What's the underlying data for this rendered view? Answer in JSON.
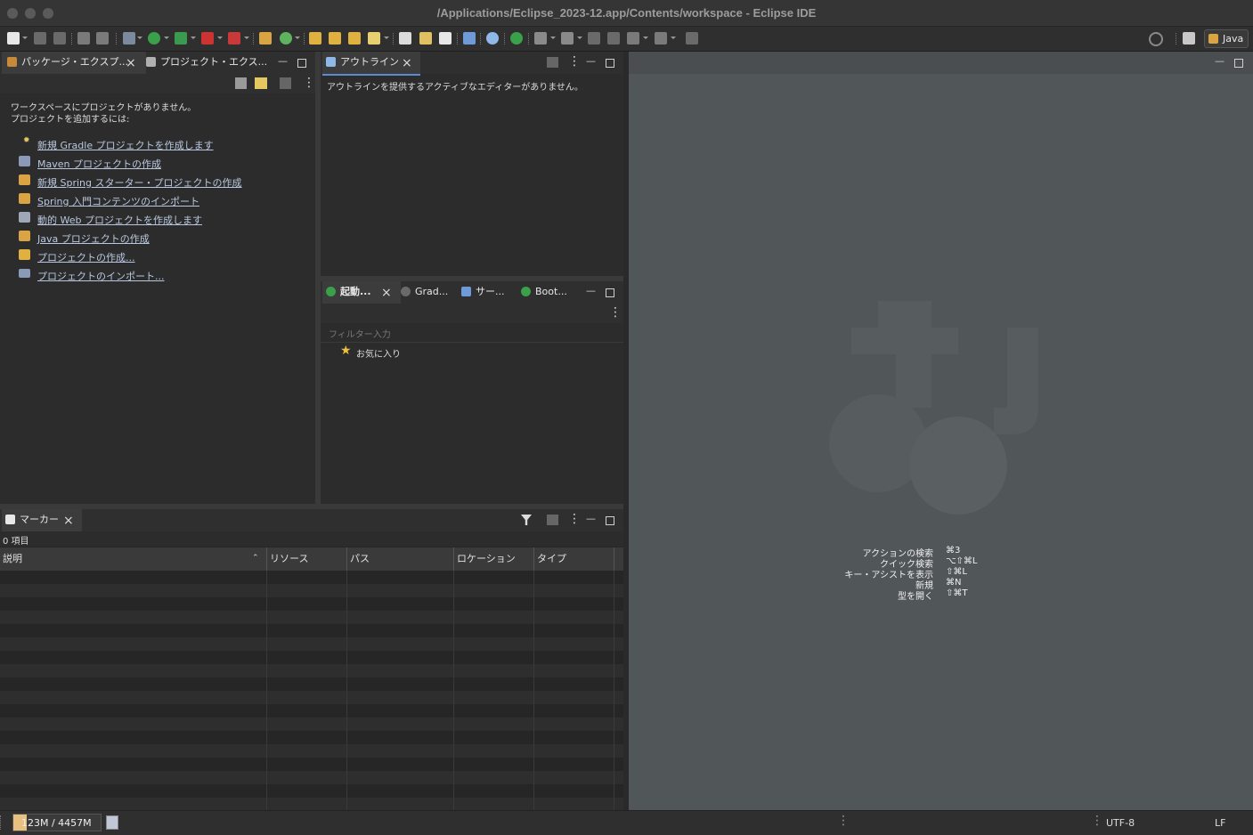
{
  "window": {
    "title": "/Applications/Eclipse_2023-12.app/Contents/workspace - Eclipse IDE"
  },
  "toolbar": {
    "perspective_label": "Java"
  },
  "package_explorer": {
    "tab_label": "パッケージ・エクスプ...",
    "second_tab_label": "プロジェクト・エクス...",
    "empty_line1": "ワークスペースにプロジェクトがありません。",
    "empty_line2": "プロジェクトを追加するには:",
    "links": [
      "新規 Gradle プロジェクトを作成します",
      "Maven プロジェクトの作成",
      "新規 Spring スターター・プロジェクトの作成",
      "Spring 入門コンテンツのインポート",
      "動的 Web プロジェクトを作成します",
      "Java プロジェクトの作成",
      "プロジェクトの作成...",
      "プロジェクトのインポート..."
    ]
  },
  "outline": {
    "tab_label": "アウトライン",
    "message": "アウトラインを提供するアクティブなエディターがありません。"
  },
  "launch_panel": {
    "tabs": [
      "起動...",
      "Grad...",
      "サー...",
      "Boot..."
    ],
    "filter_placeholder": "フィルター入力",
    "favorites_label": "お気に入り"
  },
  "markers": {
    "tab_label": "マーカー",
    "count_label": "0 項目",
    "columns": [
      "説明",
      "リソース",
      "パス",
      "ロケーション",
      "タイプ"
    ]
  },
  "editor_area": {
    "shortcuts": [
      {
        "action": "アクションの検索",
        "key": "⌘3"
      },
      {
        "action": "クイック検索",
        "key": "⌥⇧⌘L"
      },
      {
        "action": "キー・アシストを表示",
        "key": "⇧⌘L"
      },
      {
        "action": "新規",
        "key": "⌘N"
      },
      {
        "action": "型を開く",
        "key": "⇧⌘T"
      }
    ]
  },
  "status_bar": {
    "heap": "123M / 4457M",
    "heap_used_fraction": 0.03,
    "encoding": "UTF-8",
    "line_delimiter": "LF"
  }
}
